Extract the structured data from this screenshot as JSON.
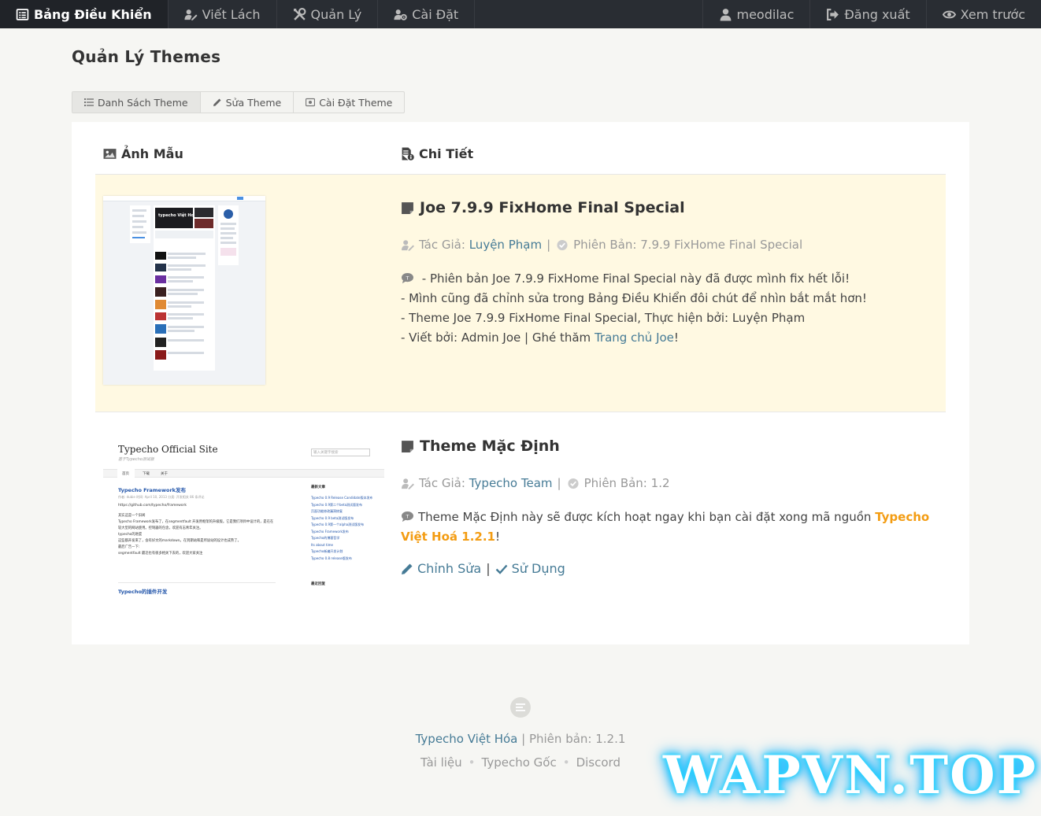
{
  "nav": {
    "left": [
      {
        "label": "Bảng Điều Khiển",
        "icon": "dashboard-icon"
      },
      {
        "label": "Viết Lách",
        "icon": "user-edit-icon"
      },
      {
        "label": "Quản Lý",
        "icon": "tools-icon"
      },
      {
        "label": "Cài Đặt",
        "icon": "user-cog-icon"
      }
    ],
    "right": [
      {
        "label": "meodilac",
        "icon": "user-icon"
      },
      {
        "label": "Đăng xuất",
        "icon": "sign-out-icon"
      },
      {
        "label": "Xem trước",
        "icon": "eye-icon"
      }
    ]
  },
  "page": {
    "title": "Quản Lý Themes"
  },
  "tabs": [
    {
      "label": "Danh Sách Theme",
      "icon": "list-icon"
    },
    {
      "label": "Sửa Theme",
      "icon": "pencil-icon"
    },
    {
      "label": "Cài Đặt Theme",
      "icon": "settings-box-icon"
    }
  ],
  "table": {
    "col_preview": "Ảnh Mẫu",
    "col_detail": "Chi Tiết"
  },
  "themes": [
    {
      "name": "Joe 7.9.9 FixHome Final Special",
      "author_label": "Tác Giả:",
      "author": "Luyện Phạm",
      "version_label": "Phiên Bản:",
      "version": "7.9.9 FixHome Final Special",
      "desc_lines": [
        "- Phiên bản Joe 7.9.9 FixHome Final Special này đã được mình fix hết lỗi!",
        "- Mình cũng đã chỉnh sửa trong Bảng Điều Khiển đôi chút để nhìn bắt mắt hơn!",
        "- Theme Joe 7.9.9 FixHome Final Special, Thực hiện bởi: Luyện Phạm"
      ],
      "desc_last_prefix": "- Viết bởi: Admin Joe | Ghé thăm ",
      "desc_last_link": "Trang chủ Joe",
      "desc_last_suffix": "!",
      "thumb": {
        "title": "typecho Việt Hoá"
      }
    },
    {
      "name": "Theme Mặc Định",
      "author_label": "Tác Giả:",
      "author": "Typecho Team",
      "version_label": "Phiên Bản:",
      "version": "1.2",
      "desc_text": "Theme Mặc Định này sẽ được kích hoạt ngay khi bạn cài đặt xong mã nguồn ",
      "desc_highlight_1": "Typecho",
      "desc_highlight_2": "Việt Hoá 1.2.1",
      "desc_end": "!",
      "action_edit": "Chỉnh Sửa",
      "action_use": "Sử Dụng",
      "thumb": {
        "site_title": "Typecho Official Site",
        "site_subtitle": "基于Typecho测试版",
        "search_placeholder": "输入关键字搜索",
        "menu": [
          "首页",
          "下载",
          "关于"
        ],
        "post_title": "Typecho Framework发布",
        "post_meta": "作者: dubie 时间: April 10, 2013 分类: 开发相关 86 条评论",
        "post_link": "https://github.com/typecho/framework",
        "post_lines": [
          "其实这是一个旧闻",
          "Typecho Framework发布了，在segmentfault 开发用框架的升级版。它是我们项目中设计的，是在在",
          "较大型的网站使用。控制器的包含，欢迎有志青年关注。",
          "typecho的进度",
          "这些都开发来了，会有好文的markdown。在到期站和是所说站的设计也成熟了。",
          "最后广告一下:",
          "segmentfault 最近也有很多相关下去的，欢迎大家关注"
        ],
        "next_post": "Typecho的插件开发",
        "sidebar_title": "最新文章",
        "sidebar_links": [
          "Typecho 0.9 Release Candidate版本发布",
          "Typecho 0.9第二个beta测试版发布",
          "页面功能修改漏洞修复",
          "Typecho 0.9 beta测试版发布",
          "Typecho 0.9第一个alpha测试版发布",
          "Typecho Framework发布",
          "Typecho的博客哲学",
          "Its about time",
          "Typecho新编开发计划",
          "Typecho 0.8 release版发布"
        ],
        "sidebar_title2": "最近回复"
      }
    }
  ],
  "footer": {
    "brand": "Typecho Việt Hóa",
    "version_text": " | Phiên bản: 1.2.1",
    "links": [
      "Tài liệu",
      "Typecho Gốc",
      "Discord"
    ]
  },
  "watermark": "WAPVN.TOP",
  "colors": {
    "topbar": "#292d33",
    "link": "#467b96",
    "highlight_row": "#fff9e2",
    "orange": "#f39c12"
  }
}
